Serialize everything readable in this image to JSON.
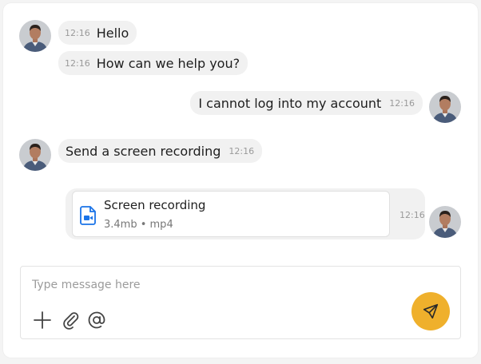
{
  "messages": [
    {
      "time": "12:16",
      "text": "Hello"
    },
    {
      "time": "12:16",
      "text": "How can we help you?"
    },
    {
      "time": "12:16",
      "text": "I cannot log into my account"
    },
    {
      "time": "12:16",
      "text": "Send a screen recording"
    }
  ],
  "attachment": {
    "name": "Screen recording",
    "meta": "3.4mb • mp4",
    "time": "12:16",
    "icon": "video-file-icon"
  },
  "composer": {
    "placeholder": "Type message here"
  },
  "icons": {
    "add": "plus-icon",
    "attach": "paperclip-icon",
    "mention": "at-sign-icon",
    "send": "send-icon"
  },
  "colors": {
    "accent": "#efb02c",
    "bubble": "#f1f1f1",
    "file_icon": "#1a73e8"
  }
}
